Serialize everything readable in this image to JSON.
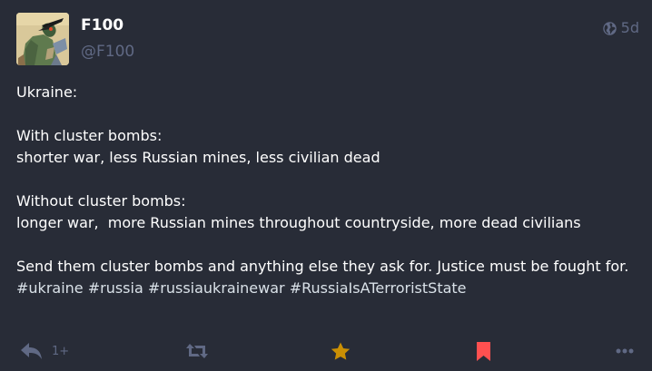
{
  "author": {
    "display_name": "F100",
    "handle": "@F100"
  },
  "meta": {
    "visibility_icon": "globe-icon",
    "timestamp": "5d"
  },
  "content": {
    "intro": "Ukraine:",
    "with_heading": "With cluster bombs:",
    "with_body": "shorter war, less Russian mines, less civilian dead",
    "without_heading": "Without cluster bombs:",
    "without_body": "longer war,  more Russian mines throughout countryside, more dead civilians",
    "closing_text": "Send them cluster bombs and anything else they ask for. Justice must be fought for. ",
    "hashtags": [
      "#ukraine",
      "#russia",
      "#russiaukrainewar",
      "#RussiaIsATerroristState"
    ]
  },
  "actions": {
    "reply_icon": "reply-icon",
    "reply_count": "1+",
    "boost_icon": "boost-icon",
    "favourite_icon": "star-icon",
    "bookmark_icon": "bookmark-icon",
    "more_icon": "more-icon"
  },
  "colors": {
    "background": "#282c37",
    "muted": "#606984",
    "favourite_active": "#ca8f04",
    "bookmark_active": "#ff5050",
    "hashtag": "#d9e1e8"
  }
}
